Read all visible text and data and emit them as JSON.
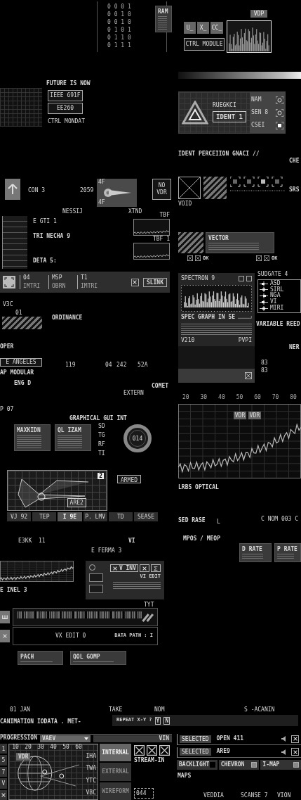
{
  "left": [
    {
      "kind": "matrix",
      "rows": [
        "0 0 0 1",
        "0 0 1 0",
        "0 0 1 0",
        "0 1 0 1",
        "0 1 1 0",
        "0 1 1 1"
      ]
    },
    {
      "kind": "card",
      "title": "RAM"
    },
    {
      "kind": "text",
      "text": "FUTURE IS NOW"
    },
    {
      "kind": "grid"
    },
    {
      "kind": "button",
      "label": "IEEE 691F"
    },
    {
      "kind": "button",
      "label": "EE260"
    },
    {
      "kind": "text",
      "text": "CTRL MONDAT"
    },
    {
      "kind": "arrow"
    },
    {
      "kind": "text",
      "text": "CON 3"
    },
    {
      "kind": "text",
      "text": "2059"
    },
    {
      "kind": "ship",
      "top": "4F",
      "bottom": "4F"
    },
    {
      "kind": "button",
      "label": "NO VDR"
    },
    {
      "kind": "text",
      "text": "NESSIJ"
    },
    {
      "kind": "text",
      "text": "XTND"
    },
    {
      "kind": "listpanel"
    },
    {
      "kind": "text",
      "text": "E GTI 1"
    },
    {
      "kind": "minichart",
      "label": "TBF"
    },
    {
      "kind": "text",
      "text": "TRI NECHA 9"
    },
    {
      "kind": "minichart",
      "label": "TBF 1"
    },
    {
      "kind": "text",
      "text": "DETA 5:"
    },
    {
      "kind": "toolbar",
      "fields": [
        {
          "value": "04",
          "label": "IMTRI"
        },
        {
          "value": "MSP",
          "label": "OBRN"
        },
        {
          "value": "T1",
          "label": "IMTRI"
        }
      ],
      "action": "SLINK"
    },
    {
      "kind": "text",
      "text": "V3C"
    },
    {
      "kind": "text",
      "text": "01"
    },
    {
      "kind": "stripes"
    },
    {
      "kind": "text",
      "text": "ORDINANCE"
    },
    {
      "kind": "text",
      "text": "OPER"
    },
    {
      "kind": "button",
      "label": "E ANGELES"
    },
    {
      "kind": "text",
      "text": "119"
    },
    {
      "kind": "text",
      "text": "04"
    },
    {
      "kind": "text",
      "text": "242"
    },
    {
      "kind": "text",
      "text": "52A"
    },
    {
      "kind": "text",
      "text": "AP MODULAR"
    },
    {
      "kind": "text",
      "text": "ENG D"
    },
    {
      "kind": "text",
      "text": "COMET"
    },
    {
      "kind": "text",
      "text": "EXTERN"
    },
    {
      "kind": "text",
      "text": "P 07"
    },
    {
      "kind": "text",
      "text": "GRAPHICAL GUI INT"
    },
    {
      "kind": "card",
      "title": "MAXKIDN"
    },
    {
      "kind": "card",
      "title": "QL IZAM"
    },
    {
      "kind": "column",
      "labels": [
        "SD",
        "TG",
        "RF",
        "TI"
      ]
    },
    {
      "kind": "ring",
      "label": "014"
    },
    {
      "kind": "wire",
      "number": "2",
      "tag": "ARE2"
    },
    {
      "kind": "button",
      "label": "ARMED"
    },
    {
      "kind": "tabs",
      "tabs": [
        {
          "label": "VJ 92",
          "selected": false
        },
        {
          "label": "TEP",
          "selected": false
        },
        {
          "label": "I 9E",
          "selected": true
        },
        {
          "label": "P. LMV",
          "selected": false
        },
        {
          "label": "TD",
          "selected": false
        },
        {
          "label": "SEASE",
          "selected": false
        }
      ]
    },
    {
      "kind": "text",
      "text": "E3KK"
    },
    {
      "kind": "text",
      "text": "11"
    },
    {
      "kind": "text",
      "text": "VI"
    },
    {
      "kind": "text",
      "text": "E FERMA 3"
    },
    {
      "kind": "linechart"
    },
    {
      "kind": "vinv",
      "button": "V INV",
      "title": "VI EDIT"
    },
    {
      "kind": "text",
      "text": "E INEL 3"
    },
    {
      "kind": "text",
      "text": "TYT"
    },
    {
      "kind": "barcode"
    },
    {
      "kind": "datapath",
      "left": "VX EDIT 0",
      "right": "DATA PATH : I"
    },
    {
      "kind": "card",
      "title": "PACH"
    },
    {
      "kind": "card",
      "title": "QOL GOMP"
    },
    {
      "kind": "text",
      "text": "01 JAN"
    },
    {
      "kind": "text",
      "text": "TAKE"
    },
    {
      "kind": "text",
      "text": "NOM"
    },
    {
      "kind": "text",
      "text": "CANIMATION IODATA . MET-"
    },
    {
      "kind": "repeat",
      "label": "REPEAT X-Y ?",
      "yes": "Y",
      "no": "N"
    },
    {
      "kind": "progression",
      "title": "PROGRESSION",
      "dropdown": "VAEV",
      "right": "VIN",
      "tag": "VDR",
      "side": [
        "1",
        "5",
        "7",
        "V"
      ],
      "xlabels": [
        "10",
        "20",
        "30",
        "40",
        "50",
        "60"
      ],
      "ylabels": [
        "IHA",
        "TWA",
        "YTC",
        "VBC"
      ],
      "modes": [
        {
          "label": "INTERNAL",
          "selected": true
        },
        {
          "label": "EXTERNAL",
          "selected": false
        },
        {
          "label": "WIREFORM",
          "selected": false
        }
      ],
      "stream": "STREAM-IN",
      "counter": "044"
    }
  ],
  "right": [
    {
      "kind": "tag",
      "label": "VDP"
    },
    {
      "kind": "tag",
      "label": "U_"
    },
    {
      "kind": "tag",
      "label": "X_"
    },
    {
      "kind": "tag",
      "label": "CC_"
    },
    {
      "kind": "histogram"
    },
    {
      "kind": "button",
      "label": "CTRL MODULE"
    },
    {
      "kind": "gradient"
    },
    {
      "kind": "ident",
      "subtitle": "RUEGKCI",
      "title": "IDENT 1",
      "sensors": [
        "NAM",
        "SEN 8",
        "CSEI"
      ]
    },
    {
      "kind": "text",
      "text": "IDENT PERCEIION GNACI //"
    },
    {
      "kind": "text",
      "text": "CHE"
    },
    {
      "kind": "xbox"
    },
    {
      "kind": "stripes"
    },
    {
      "kind": "squares"
    },
    {
      "kind": "text",
      "text": "SRS"
    },
    {
      "kind": "text",
      "text": "VOID"
    },
    {
      "kind": "stripes"
    },
    {
      "kind": "card",
      "title": "VECTOR"
    },
    {
      "kind": "ok",
      "label": "OK"
    },
    {
      "kind": "ok",
      "label": "OK"
    },
    {
      "kind": "spectrum",
      "title": "SPECTRON 9",
      "caption": "SPEC GRAPH IN 5E",
      "left": "V210",
      "right": "PVPI"
    },
    {
      "kind": "sudgate",
      "title": "SUDGATE 4",
      "items": [
        "ASD",
        "SIRL",
        "NGA",
        "VI",
        "MIRI"
      ]
    },
    {
      "kind": "text",
      "text": "VARIABLE REED"
    },
    {
      "kind": "text",
      "text": "NER"
    },
    {
      "kind": "text",
      "text": "83"
    },
    {
      "kind": "text",
      "text": "83"
    },
    {
      "kind": "axis",
      "labels": [
        "20",
        "30",
        "40",
        "50",
        "60",
        "70",
        "80"
      ]
    },
    {
      "kind": "linechart",
      "tags": [
        "VDR",
        "VDR"
      ]
    },
    {
      "kind": "text",
      "text": "LRBS OPTICAL"
    },
    {
      "kind": "text",
      "text": "SED RASE"
    },
    {
      "kind": "text",
      "text": "L"
    },
    {
      "kind": "text",
      "text": "C NOM 003 C"
    },
    {
      "kind": "text",
      "text": "MPOS / MEOP"
    },
    {
      "kind": "card",
      "title": "D RATE"
    },
    {
      "kind": "card",
      "title": "P RATE"
    },
    {
      "kind": "text",
      "text": "S -ACANIN"
    },
    {
      "kind": "selected",
      "rows": [
        {
          "tag": "SELECTED",
          "value": "OPEN 411"
        },
        {
          "tag": "SELECTED",
          "value": "ARE9"
        }
      ]
    },
    {
      "kind": "toggles",
      "items": [
        {
          "label": "BACKLIGHT",
          "on": true
        },
        {
          "label": "CHEVRON",
          "on": false
        },
        {
          "label": "I-MAP",
          "on": false
        }
      ]
    },
    {
      "kind": "text",
      "text": "MAPS"
    },
    {
      "kind": "text",
      "text": "VEDDIA"
    },
    {
      "kind": "text",
      "text": "SCANSE 7"
    },
    {
      "kind": "text",
      "text": "VION"
    }
  ]
}
